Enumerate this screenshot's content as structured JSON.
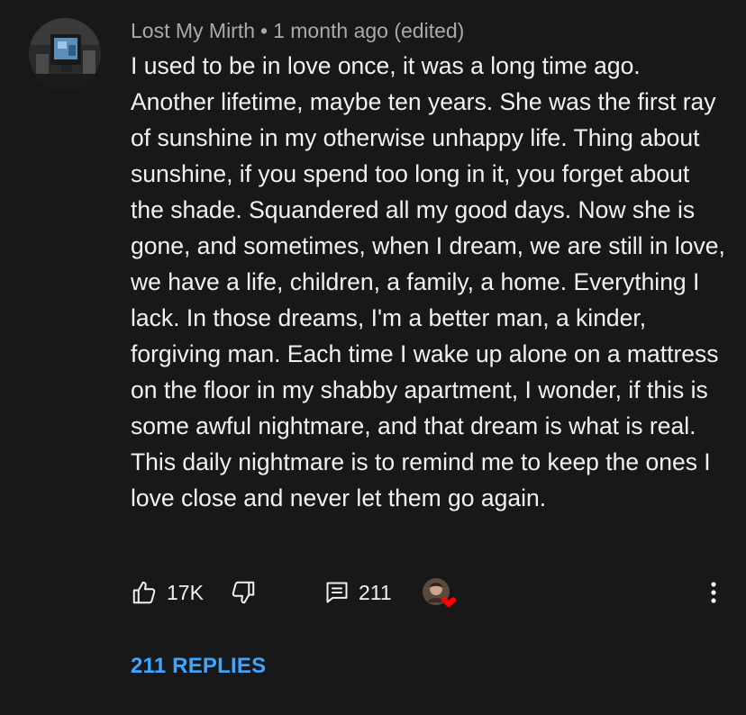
{
  "comment": {
    "author": "Lost My Mirth",
    "separator": "•",
    "timestamp": "1 month ago",
    "edited": "(edited)",
    "text": "I used to be in love once, it was a long time ago. Another lifetime, maybe ten years. She was the first ray of sunshine in my otherwise unhappy life. Thing about sunshine, if you spend too long in it, you forget about the shade. Squandered all my good days. Now she is gone, and sometimes, when I dream, we are still in love, we have a life, children, a family, a home. Everything I lack. In those dreams, I'm a better man, a kinder, forgiving man. Each time I wake up alone on a mattress on the floor in my shabby apartment, I wonder, if this is some awful nightmare, and that dream is what is real. This daily nightmare is to remind me to keep the ones I love close and never let them go again."
  },
  "actions": {
    "like_icon": "thumbs-up-icon",
    "like_count": "17K",
    "dislike_icon": "thumbs-down-icon",
    "reply_icon": "comment-icon",
    "reply_count": "211",
    "creator_heart_icon": "creator-heart-icon",
    "more_icon": "more-vertical-icon"
  },
  "replies_link": "211 REPLIES",
  "colors": {
    "background": "#181818",
    "text": "#f1f1f1",
    "meta": "#aaaaaa",
    "link": "#3ea6ff",
    "heart": "#ff0000"
  }
}
